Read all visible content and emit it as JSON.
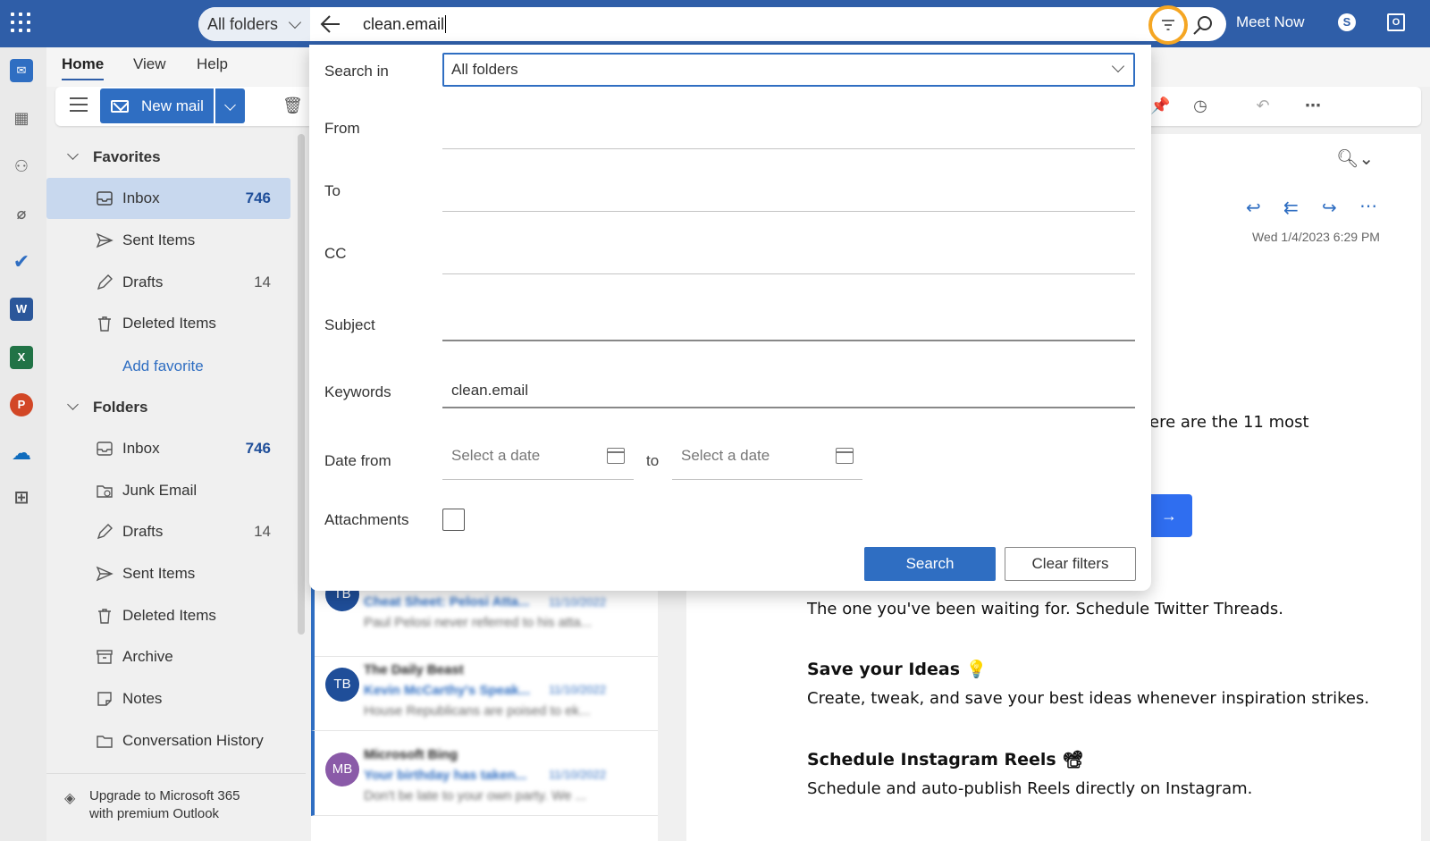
{
  "topbar": {
    "search_scope": "All folders",
    "search_query": "clean.email",
    "meet_now": "Meet Now"
  },
  "ribbon": {
    "tabs": [
      "Home",
      "View",
      "Help"
    ],
    "new_mail": "New mail"
  },
  "folders": {
    "favorites_label": "Favorites",
    "favorites": [
      {
        "label": "Inbox",
        "count": "746"
      },
      {
        "label": "Sent Items",
        "count": ""
      },
      {
        "label": "Drafts",
        "count": "14"
      },
      {
        "label": "Deleted Items",
        "count": ""
      }
    ],
    "add_favorite": "Add favorite",
    "folders_label": "Folders",
    "items": [
      {
        "label": "Inbox",
        "count": "746"
      },
      {
        "label": "Junk Email",
        "count": ""
      },
      {
        "label": "Drafts",
        "count": "14"
      },
      {
        "label": "Sent Items",
        "count": ""
      },
      {
        "label": "Deleted Items",
        "count": ""
      },
      {
        "label": "Archive",
        "count": ""
      },
      {
        "label": "Notes",
        "count": ""
      },
      {
        "label": "Conversation History",
        "count": ""
      }
    ],
    "upgrade_line1": "Upgrade to Microsoft 365",
    "upgrade_line2": "with premium Outlook"
  },
  "messages": [
    {
      "initials": "TB",
      "sender": "",
      "subject": "Cheat Sheet: Pelosi Atta...",
      "date": "11/10/2022",
      "preview": "Paul Pelosi never referred to his atta...",
      "color": "#1f4e99"
    },
    {
      "initials": "TB",
      "sender": "The Daily Beast",
      "subject": "Kevin McCarthy's Speak...",
      "date": "11/10/2022",
      "preview": "House Republicans are poised to ek...",
      "color": "#1f4e99"
    },
    {
      "initials": "MB",
      "sender": "Microsoft Bing",
      "subject": "Your birthday has taken...",
      "date": "11/10/2022",
      "preview": "Don't be late to your own party. We ...",
      "color": "#8a5aa8"
    }
  ],
  "reading": {
    "date": "Wed 1/4/2023 6:29 PM",
    "partial_line": "ere are the 11 most",
    "cta_arrow": "→",
    "line1": "The one you've been waiting for. Schedule Twitter Threads.",
    "heading2": "Save your Ideas 💡",
    "line2": "Create, tweak, and save your best ideas whenever inspiration strikes.",
    "heading3": "Schedule Instagram Reels 📽",
    "line3": "Schedule and auto-publish Reels directly on Instagram."
  },
  "filter": {
    "search_in_label": "Search in",
    "search_in_value": "All folders",
    "from_label": "From",
    "to_label": "To",
    "cc_label": "CC",
    "subject_label": "Subject",
    "keywords_label": "Keywords",
    "keywords_value": "clean.email",
    "date_from_label": "Date from",
    "date_placeholder": "Select a date",
    "to_word": "to",
    "attachments_label": "Attachments",
    "search_button": "Search",
    "clear_button": "Clear filters"
  },
  "colors": {
    "brand": "#2f5ea8",
    "accent": "#2f6ec2",
    "highlight_ring": "#f5a623"
  }
}
